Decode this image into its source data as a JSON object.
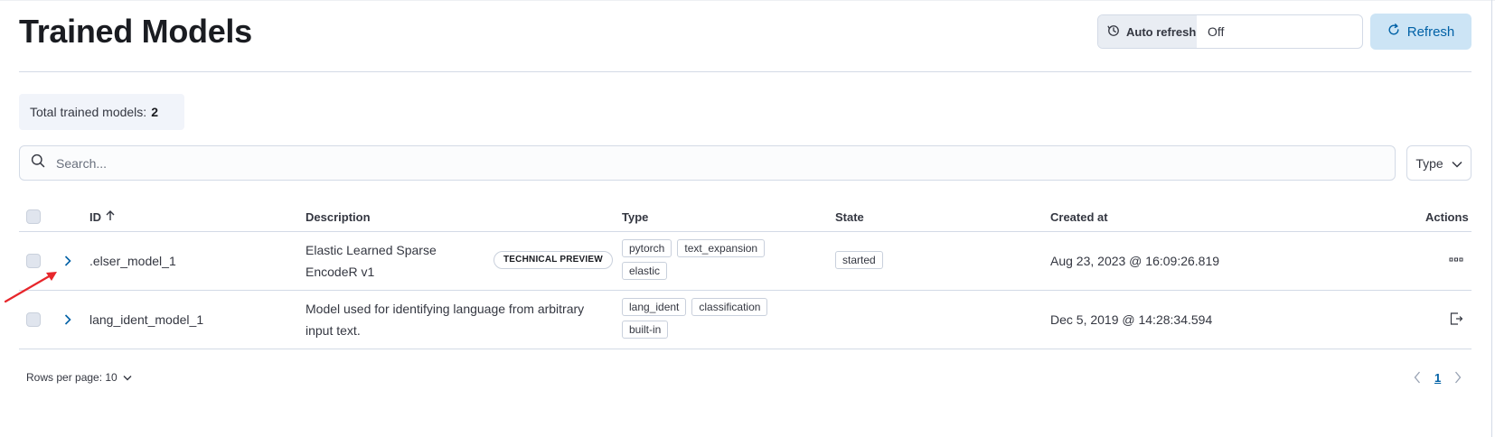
{
  "page": {
    "title": "Trained Models"
  },
  "header": {
    "auto_refresh_label": "Auto refresh",
    "auto_refresh_value": "Off",
    "refresh_label": "Refresh"
  },
  "summary": {
    "label": "Total trained models:",
    "count": "2"
  },
  "search": {
    "placeholder": "Search...",
    "type_filter_label": "Type"
  },
  "table": {
    "columns": {
      "id": "ID",
      "description": "Description",
      "type": "Type",
      "state": "State",
      "created_at": "Created at",
      "actions": "Actions"
    },
    "sort_icon": "arrow-up-icon",
    "rows": [
      {
        "id": ".elser_model_1",
        "description": "Elastic Learned Sparse EncodeR v1",
        "badge": "TECHNICAL PREVIEW",
        "types": [
          "pytorch",
          "text_expansion",
          "elastic"
        ],
        "state": "started",
        "created_at": "Aug 23, 2023 @ 16:09:26.819",
        "action_icon": "ellipsis-icon"
      },
      {
        "id": "lang_ident_model_1",
        "description": "Model used for identifying language from arbitrary input text.",
        "types": [
          "lang_ident",
          "classification",
          "built-in"
        ],
        "state": "",
        "created_at": "Dec 5, 2019 @ 14:28:34.594",
        "action_icon": "export-icon"
      }
    ]
  },
  "footer": {
    "rows_per_page": "Rows per page: 10",
    "current_page": "1"
  },
  "colors": {
    "accent": "#0061a6",
    "refresh_bg": "#cce4f5",
    "annotation": "#e7262b",
    "border": "#d3dae6"
  }
}
